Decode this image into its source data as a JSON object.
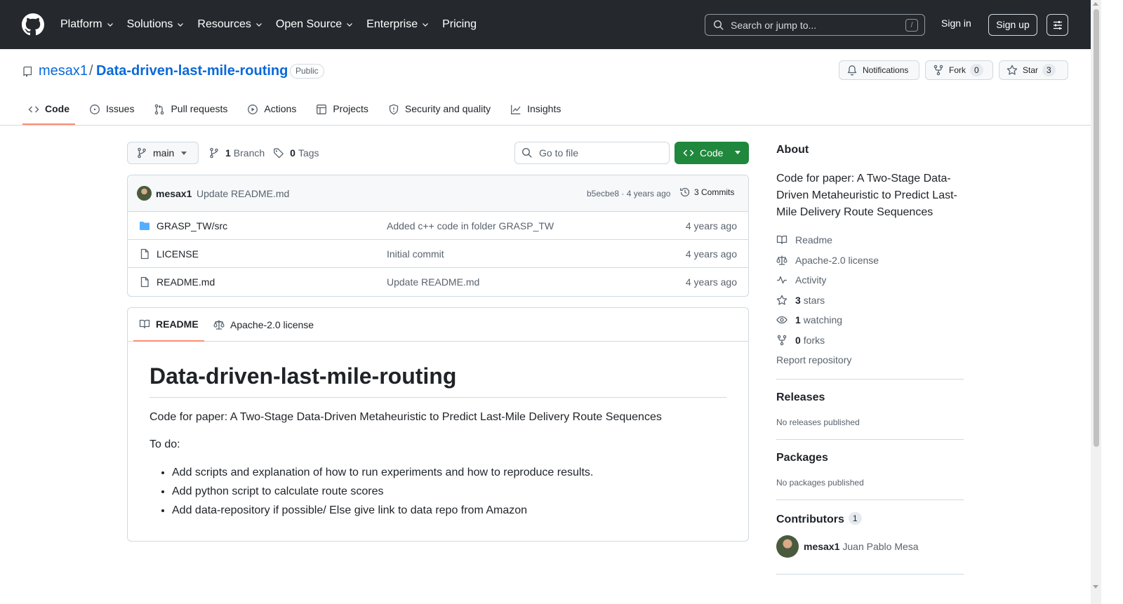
{
  "header": {
    "nav": [
      "Platform",
      "Solutions",
      "Resources",
      "Open Source",
      "Enterprise",
      "Pricing"
    ],
    "search_placeholder": "Search or jump to...",
    "search_shortcut": "/",
    "signin": "Sign in",
    "signup": "Sign up"
  },
  "repo": {
    "owner": "mesax1",
    "separator": "/",
    "name": "Data-driven-last-mile-routing",
    "visibility": "Public",
    "notifications": "Notifications",
    "fork_label": "Fork",
    "fork_count": "0",
    "star_label": "Star",
    "star_count": "3",
    "tabs": [
      "Code",
      "Issues",
      "Pull requests",
      "Actions",
      "Projects",
      "Security and quality",
      "Insights"
    ]
  },
  "branch": {
    "name": "main",
    "branches_count": "1",
    "branches_label": "Branch",
    "tags_count": "0",
    "tags_label": "Tags",
    "goto_placeholder": "Go to file",
    "code_label": "Code"
  },
  "commit": {
    "author": "mesax1",
    "message": "Update README.md",
    "meta": "b5ecbe8 · 4 years ago",
    "commits": "3 Commits"
  },
  "files": [
    {
      "name": "GRASP_TW/src",
      "type": "folder",
      "message": "Added c++ code in folder GRASP_TW",
      "time": "4 years ago"
    },
    {
      "name": "LICENSE",
      "type": "file",
      "message": "Initial commit",
      "time": "4 years ago"
    },
    {
      "name": "README.md",
      "type": "file",
      "message": "Update README.md",
      "time": "4 years ago"
    }
  ],
  "readme": {
    "tabs": [
      "README",
      "Apache-2.0 license"
    ],
    "title": "Data-driven-last-mile-routing",
    "description": "Code for paper: A Two-Stage Data-Driven Metaheuristic to Predict Last-Mile Delivery Route Sequences",
    "todo_label": "To do:",
    "todo": [
      "Add scripts and explanation of how to run experiments and how to reproduce results.",
      "Add python script to calculate route scores",
      "Add data-repository if possible/ Else give link to data repo from Amazon"
    ]
  },
  "sidebar": {
    "about_title": "About",
    "about_desc": "Code for paper: A Two-Stage Data-Driven Metaheuristic to Predict Last-Mile Delivery Route Sequences",
    "readme": "Readme",
    "license": "Apache-2.0 license",
    "activity": "Activity",
    "stars_count": "3",
    "stars_label": "stars",
    "watching_count": "1",
    "watching_label": "watching",
    "forks_count": "0",
    "forks_label": "forks",
    "report": "Report repository",
    "releases_title": "Releases",
    "releases_empty": "No releases published",
    "packages_title": "Packages",
    "packages_empty": "No packages published",
    "contributors_title": "Contributors",
    "contributors_count": "1",
    "contributor_login": "mesax1",
    "contributor_name": "Juan Pablo Mesa"
  },
  "colors": {
    "header_bg": "#25292e",
    "link": "#0969da",
    "accent_green": "#1f883d",
    "tab_underline": "#fd8c73",
    "folder": "#54aeff"
  }
}
